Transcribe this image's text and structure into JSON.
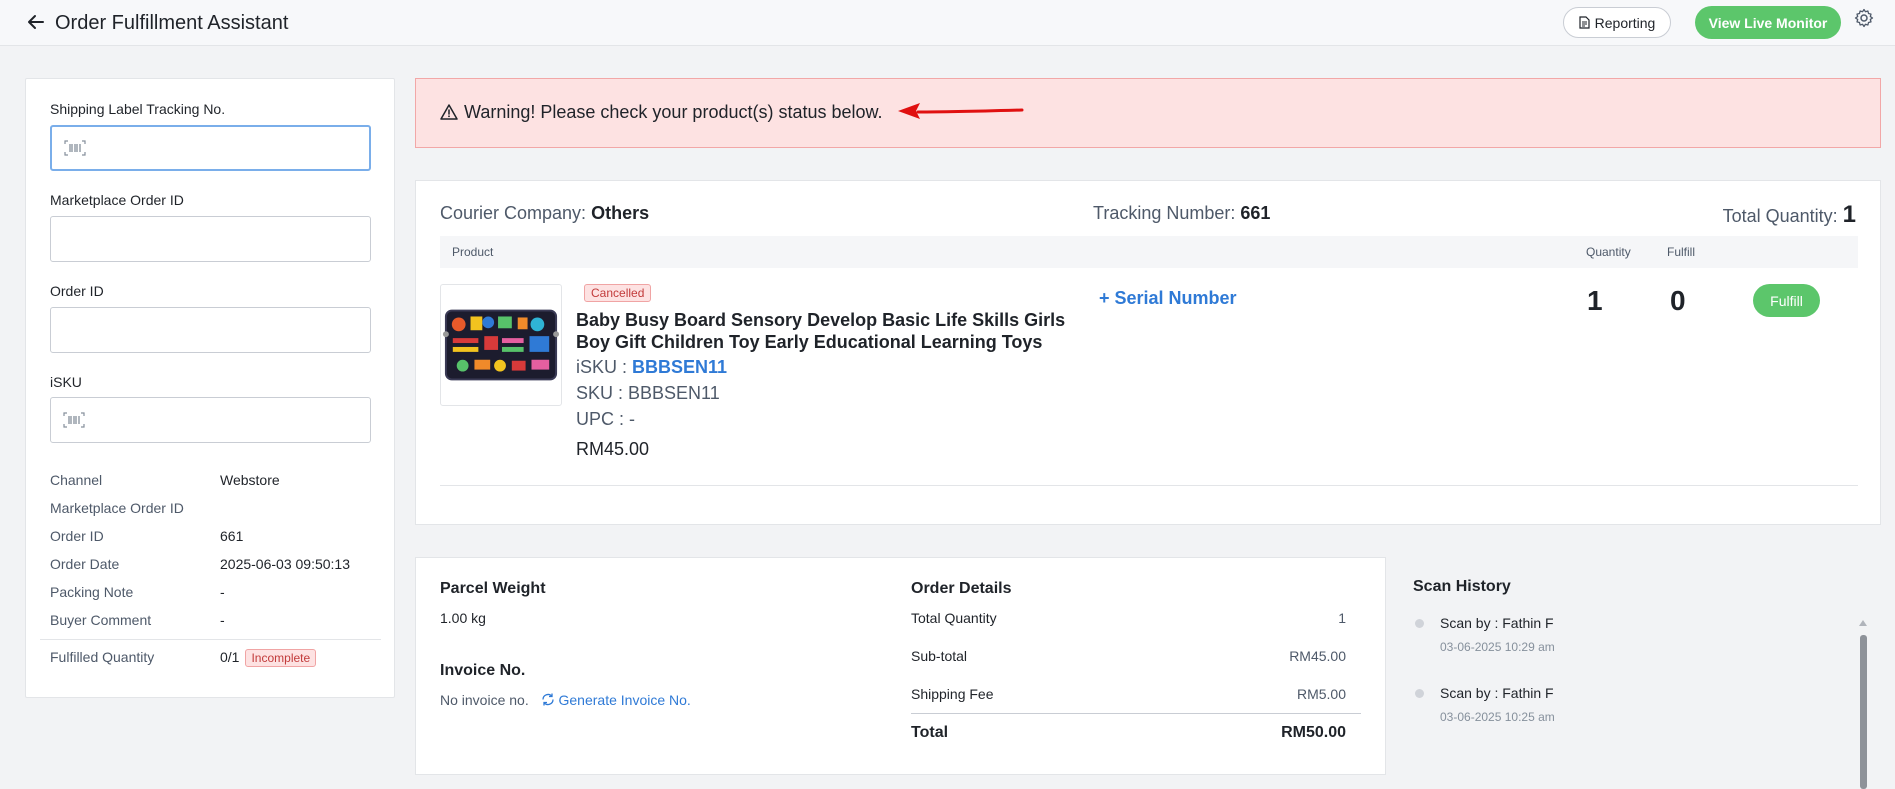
{
  "header": {
    "title": "Order Fulfillment Assistant",
    "reporting_label": "Reporting",
    "live_monitor_label": "View Live Monitor"
  },
  "search": {
    "tracking_label": "Shipping Label Tracking No.",
    "marketplace_label": "Marketplace Order ID",
    "order_id_label": "Order ID",
    "isku_label": "iSKU",
    "tracking_value": "",
    "marketplace_value": "",
    "order_id_value": "",
    "isku_value": ""
  },
  "order_info": [
    {
      "key": "Channel",
      "value": "Webstore"
    },
    {
      "key": "Marketplace Order ID",
      "value": ""
    },
    {
      "key": "Order ID",
      "value": "661"
    },
    {
      "key": "Order Date",
      "value": "2025-06-03 09:50:13"
    },
    {
      "key": "Packing Note",
      "value": "-"
    },
    {
      "key": "Buyer Comment",
      "value": "-"
    }
  ],
  "fulfilled": {
    "label": "Fulfilled Quantity",
    "value": "0/1",
    "status": "Incomplete"
  },
  "warning": {
    "text": "Warning! Please check your product(s) status below."
  },
  "shipment": {
    "courier_label": "Courier Company:",
    "courier_value": "Others",
    "tracking_label": "Tracking Number:",
    "tracking_value": "661",
    "total_label": "Total Quantity:",
    "total_value": "1"
  },
  "table": {
    "col_product": "Product",
    "col_quantity": "Quantity",
    "col_fulfill": "Fulfill"
  },
  "product": {
    "status": "Cancelled",
    "name": "Baby Busy Board Sensory Develop Basic Life Skills Girls Boy Gift Children Toy Early Educational Learning Toys",
    "isku_label": "iSKU :",
    "isku": "BBBSEN11",
    "sku": "SKU : BBBSEN11",
    "upc": "UPC : -",
    "price": "RM45.00",
    "serial_label": "+ Serial Number",
    "quantity": "1",
    "fulfilled": "0",
    "fulfill_button": "Fulfill"
  },
  "parcel": {
    "weight_title": "Parcel Weight",
    "weight_value": "1.00 kg",
    "invoice_title": "Invoice No.",
    "invoice_value": "No invoice no.",
    "generate_label": "Generate Invoice No."
  },
  "order_details": {
    "title": "Order Details",
    "rows": [
      {
        "label": "Total Quantity",
        "value": "1"
      },
      {
        "label": "Sub-total",
        "value": "RM45.00"
      },
      {
        "label": "Shipping Fee",
        "value": "RM5.00"
      }
    ],
    "total_label": "Total",
    "total_value": "RM50.00"
  },
  "scan_history": {
    "title": "Scan History",
    "items": [
      {
        "by": "Scan by : Fathin F",
        "time": "03-06-2025 10:29 am"
      },
      {
        "by": "Scan by : Fathin F",
        "time": "03-06-2025 10:25 am"
      }
    ]
  },
  "colors": {
    "accent_green": "#5cc66b",
    "link_blue": "#2f7ad6",
    "warning_bg": "#fde2e2",
    "arrow_red": "#e01010"
  }
}
